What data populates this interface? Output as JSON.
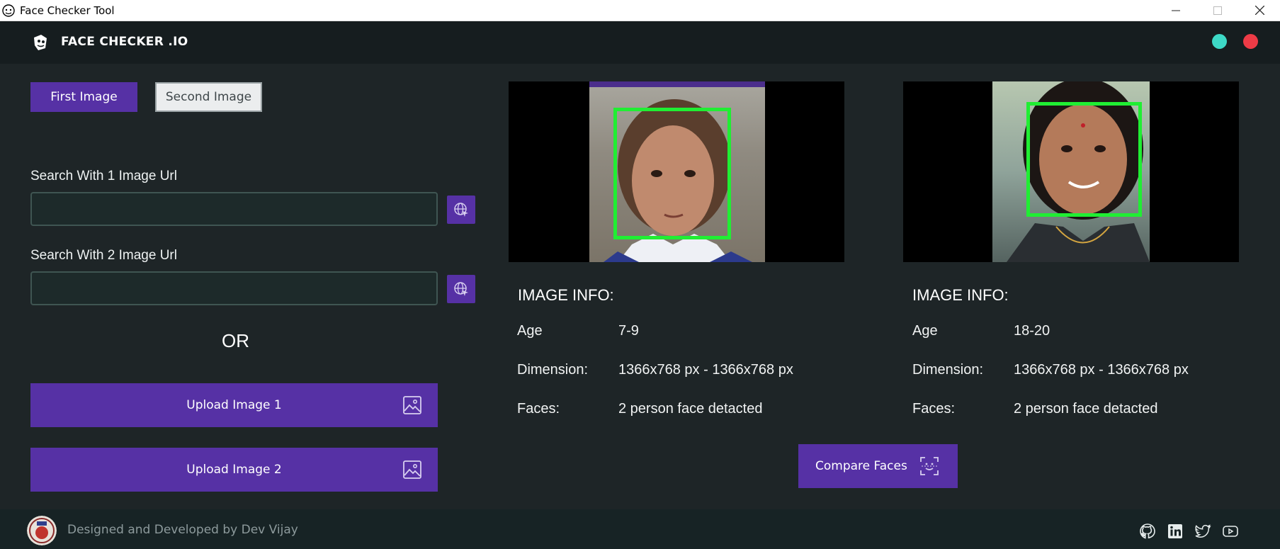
{
  "window": {
    "title": "Face Checker Tool"
  },
  "header": {
    "brand": "FACE CHECKER .IO"
  },
  "tabs": [
    {
      "label": "First Image",
      "active": true
    },
    {
      "label": "Second Image",
      "active": false
    }
  ],
  "search": {
    "label_1": "Search With 1 Image Url",
    "value_1": "",
    "label_2": "Search With 2 Image Url",
    "value_2": ""
  },
  "or_text": "OR",
  "upload": {
    "button_1": "Upload Image 1",
    "button_2": "Upload Image 2"
  },
  "images": [
    {
      "info_title": "IMAGE INFO:",
      "age_label": "Age",
      "age": "7-9",
      "dimension_label": "Dimension:",
      "dimension": "1366x768 px - 1366x768 px",
      "faces_label": "Faces:",
      "faces": "2 person face detacted"
    },
    {
      "info_title": "IMAGE INFO:",
      "age_label": "Age",
      "age": "18-20",
      "dimension_label": "Dimension:",
      "dimension": "1366x768 px - 1366x768 px",
      "faces_label": "Faces:",
      "faces": "2 person face detacted"
    }
  ],
  "compare_button": "Compare Faces",
  "footer": {
    "credit": "Designed and Developed by Dev Vijay"
  },
  "colors": {
    "accent": "#5631a5",
    "background": "#1e2527",
    "header": "#161d1f",
    "face_box": "#20ee33",
    "dot_teal": "#3dd9c6",
    "dot_red": "#ee3b46"
  },
  "icons": {
    "social": [
      "github-icon",
      "linkedin-icon",
      "twitter-icon",
      "youtube-icon"
    ]
  }
}
